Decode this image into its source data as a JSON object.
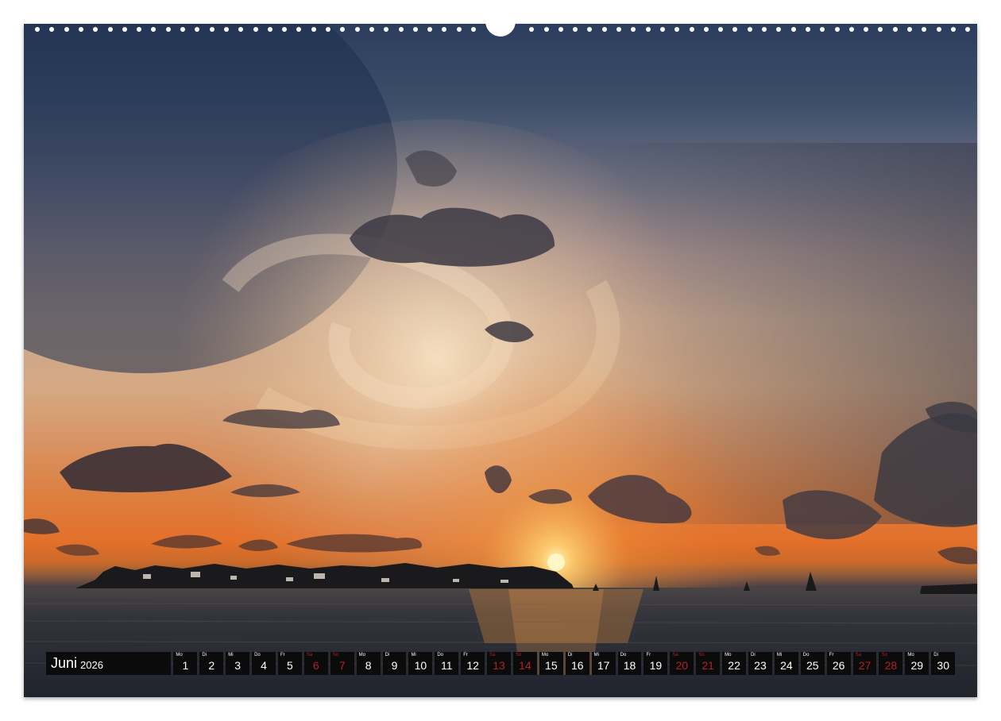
{
  "calendar": {
    "month": "Juni",
    "year": "2026",
    "days": [
      {
        "wd": "Mo",
        "n": "1",
        "weekend": false
      },
      {
        "wd": "Di",
        "n": "2",
        "weekend": false
      },
      {
        "wd": "Mi",
        "n": "3",
        "weekend": false
      },
      {
        "wd": "Do",
        "n": "4",
        "weekend": false
      },
      {
        "wd": "Fr",
        "n": "5",
        "weekend": false
      },
      {
        "wd": "Sa",
        "n": "6",
        "weekend": true
      },
      {
        "wd": "So",
        "n": "7",
        "weekend": true
      },
      {
        "wd": "Mo",
        "n": "8",
        "weekend": false
      },
      {
        "wd": "Di",
        "n": "9",
        "weekend": false
      },
      {
        "wd": "Mi",
        "n": "10",
        "weekend": false
      },
      {
        "wd": "Do",
        "n": "11",
        "weekend": false
      },
      {
        "wd": "Fr",
        "n": "12",
        "weekend": false
      },
      {
        "wd": "Sa",
        "n": "13",
        "weekend": true
      },
      {
        "wd": "So",
        "n": "14",
        "weekend": true
      },
      {
        "wd": "Mo",
        "n": "15",
        "weekend": false
      },
      {
        "wd": "Di",
        "n": "16",
        "weekend": false
      },
      {
        "wd": "Mi",
        "n": "17",
        "weekend": false
      },
      {
        "wd": "Do",
        "n": "18",
        "weekend": false
      },
      {
        "wd": "Fr",
        "n": "19",
        "weekend": false
      },
      {
        "wd": "Sa",
        "n": "20",
        "weekend": true
      },
      {
        "wd": "So",
        "n": "21",
        "weekend": true
      },
      {
        "wd": "Mo",
        "n": "22",
        "weekend": false
      },
      {
        "wd": "Di",
        "n": "23",
        "weekend": false
      },
      {
        "wd": "Mi",
        "n": "24",
        "weekend": false
      },
      {
        "wd": "Do",
        "n": "25",
        "weekend": false
      },
      {
        "wd": "Fr",
        "n": "26",
        "weekend": false
      },
      {
        "wd": "Sa",
        "n": "27",
        "weekend": true
      },
      {
        "wd": "So",
        "n": "28",
        "weekend": true
      },
      {
        "wd": "Mo",
        "n": "29",
        "weekend": false
      },
      {
        "wd": "Di",
        "n": "30",
        "weekend": false
      }
    ]
  },
  "colors": {
    "strip_background": "#0b0b0b",
    "weekend_text": "#b3202a",
    "weekday_text": "#ffffff"
  }
}
